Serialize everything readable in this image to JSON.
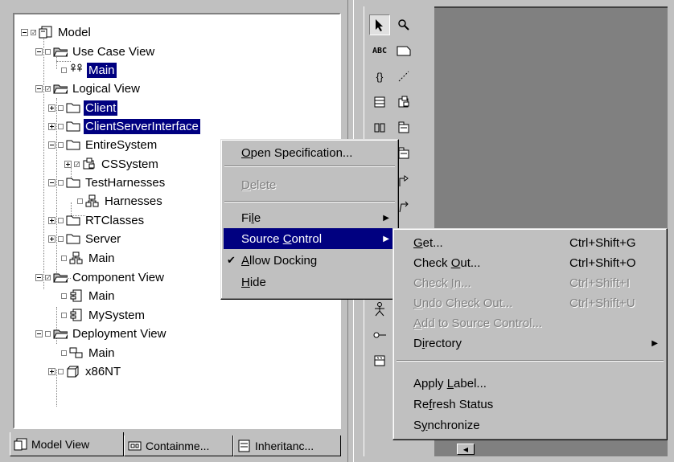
{
  "tree": {
    "nodes": [
      {
        "label": "Model"
      },
      {
        "label": "Use Case View"
      },
      {
        "label": "Main"
      },
      {
        "label": "Logical View"
      },
      {
        "label": "Client"
      },
      {
        "label": "ClientServerInterface"
      },
      {
        "label": "EntireSystem"
      },
      {
        "label": "CSSystem"
      },
      {
        "label": "TestHarnesses"
      },
      {
        "label": "Harnesses"
      },
      {
        "label": "RTClasses"
      },
      {
        "label": "Server"
      },
      {
        "label": "Main"
      },
      {
        "label": "Component View"
      },
      {
        "label": "Main"
      },
      {
        "label": "MySystem"
      },
      {
        "label": "Deployment View"
      },
      {
        "label": "Main"
      },
      {
        "label": "x86NT"
      }
    ]
  },
  "tabs": [
    {
      "label": "Model View"
    },
    {
      "label": "Containme..."
    },
    {
      "label": "Inheritanc..."
    }
  ],
  "toolbox": {
    "text_tool": "ABC",
    "braces_tool": "{}"
  },
  "context_menu": {
    "items": [
      {
        "pre": "",
        "u": "O",
        "post": "pen Specification..."
      },
      {
        "pre": "",
        "u": "D",
        "post": "elete"
      },
      {
        "pre": "Fi",
        "u": "l",
        "post": "e"
      },
      {
        "pre": "Source ",
        "u": "C",
        "post": "ontrol"
      },
      {
        "pre": "",
        "u": "A",
        "post": "llow Docking"
      },
      {
        "pre": "",
        "u": "H",
        "post": "ide"
      }
    ],
    "check_mark": "✔"
  },
  "submenu": {
    "items": [
      {
        "pre": "",
        "u": "G",
        "post": "et...",
        "shortcut": "Ctrl+Shift+G"
      },
      {
        "pre": "Check ",
        "u": "O",
        "post": "ut...",
        "shortcut": "Ctrl+Shift+O"
      },
      {
        "pre": "Check ",
        "u": "I",
        "post": "n...",
        "shortcut": "Ctrl+Shift+I"
      },
      {
        "pre": "",
        "u": "U",
        "post": "ndo Check Out...",
        "shortcut": "Ctrl+Shift+U"
      },
      {
        "pre": "",
        "u": "A",
        "post": "dd to Source Control...",
        "shortcut": ""
      },
      {
        "pre": "D",
        "u": "i",
        "post": "rectory",
        "shortcut": ""
      },
      {
        "pre": "Apply ",
        "u": "L",
        "post": "abel...",
        "shortcut": ""
      },
      {
        "pre": "Re",
        "u": "f",
        "post": "resh Status",
        "shortcut": ""
      },
      {
        "pre": "S",
        "u": "y",
        "post": "nchronize",
        "shortcut": ""
      }
    ]
  },
  "colors": {
    "selection": "#000080",
    "face": "#c0c0c0",
    "canvas": "#808080"
  }
}
